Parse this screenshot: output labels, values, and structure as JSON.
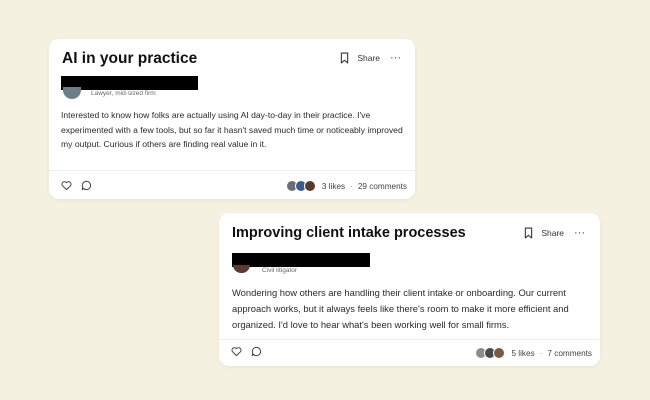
{
  "cards": [
    {
      "title": "AI in your practice",
      "share_label": "Share",
      "author_role": "Lawyer, mid-sized firm",
      "body": "Interested to know how folks are actually using AI day-to-day in their practice. I've experimented with a few tools, but so far it hasn't saved much time or noticeably improved my output. Curious if others are finding real value in it.",
      "likes": "3 likes",
      "comments": "29 comments",
      "reactor_colors": [
        "#6b6f74",
        "#3c5a8c",
        "#5a3a2e"
      ]
    },
    {
      "title": "Improving client intake processes",
      "share_label": "Share",
      "author_role": "Civil litigator",
      "body": "Wondering how others are handling their client intake or onboarding. Our current approach works, but it always feels like there's room to make it more efficient and organized. I'd love to hear what's been working well for small firms.",
      "likes": "5 likes",
      "comments": "7 comments",
      "reactor_colors": [
        "#8c8c8c",
        "#4a4a4a",
        "#7a5a44"
      ]
    }
  ]
}
